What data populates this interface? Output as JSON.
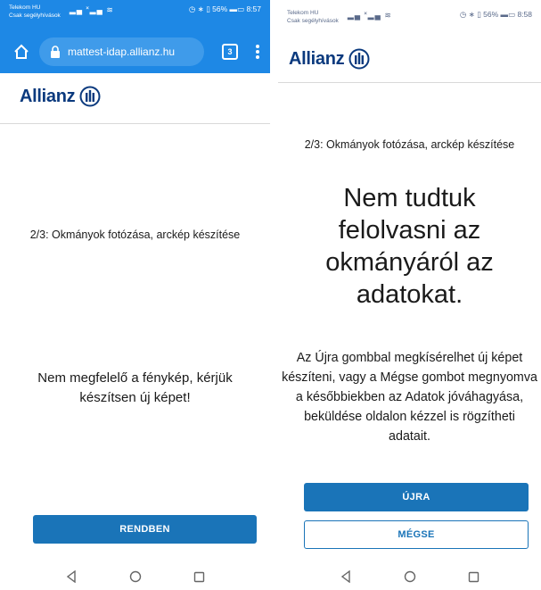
{
  "colors": {
    "chrome_blue": "#1e88e5",
    "allianz_blue": "#0b3a7e",
    "button_blue": "#1a74b8"
  },
  "left_screen": {
    "status_bar": {
      "carrier_line1": "Telekom HU",
      "carrier_line2": "Csak segélyhívások",
      "signal": "▂▄ ˟▂▄ ≋",
      "indicators": "◷ ∗ ▯ 56% ▬▭ 8:57"
    },
    "browser": {
      "url": "mattest-idap.allianz.hu",
      "tab_count": "3"
    },
    "brand": {
      "name": "Allianz"
    },
    "step_text": "2/3: Okmányok fotózása, arckép készítése",
    "message": "Nem megfelelő a fénykép, kérjük készítsen új képet!",
    "ok_button": "RENDBEN"
  },
  "right_screen": {
    "status_bar": {
      "carrier_line1": "Telekom HU",
      "carrier_line2": "Csak segélyhívások",
      "signal": "▂▄ ˟▂▄ ≋",
      "indicators": "◷ ∗ ▯ 56% ▬▭ 8:58"
    },
    "brand": {
      "name": "Allianz"
    },
    "step_text": "2/3: Okmányok fotózása, arckép készítése",
    "heading": "Nem tudtuk felolvasni az okmányáról az adatokat.",
    "description": "Az Újra gombbal megkísérelhet új képet készíteni, vagy a Mégse gombot megnyomva a későbbiekben az Adatok jóváhagyása, beküldése oldalon kézzel is rögzítheti adatait.",
    "retry_button": "ÚJRA",
    "cancel_button": "MÉGSE"
  }
}
